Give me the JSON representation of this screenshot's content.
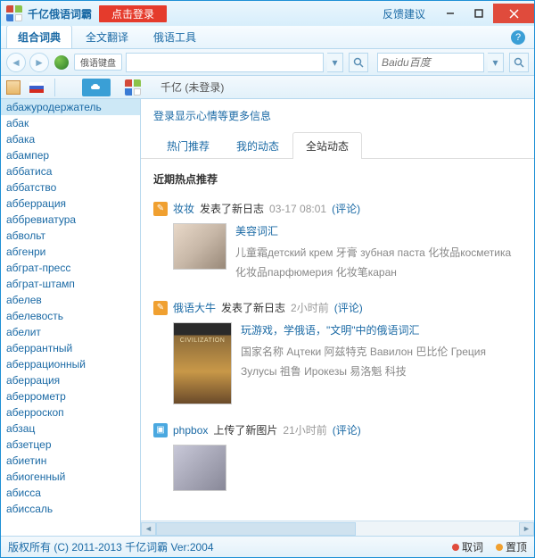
{
  "titlebar": {
    "app_title": "千亿俄语词霸",
    "login_btn": "点击登录",
    "feedback": "反馈建议"
  },
  "menubar": {
    "tabs": [
      "组合词典",
      "全文翻译",
      "俄语工具"
    ]
  },
  "toolbar": {
    "kb_chip": "俄语键盘",
    "baidu_placeholder": "Baidu百度"
  },
  "iconbar": {
    "qianyi_label": "千亿 (未登录)"
  },
  "sidebar": {
    "words": [
      "абажуродержатель",
      "абак",
      "абака",
      "абампер",
      "аббатиса",
      "аббатство",
      "абберрация",
      "аббревиатура",
      "абвольт",
      "абгенри",
      "абграт-пресс",
      "абграт-штамп",
      "абелев",
      "абелевость",
      "абелит",
      "аберрантный",
      "аберрационный",
      "аберрация",
      "аберрометр",
      "аберроскоп",
      "абзац",
      "абзетцер",
      "абиетин",
      "абиогенный",
      "абисса",
      "абиссаль"
    ]
  },
  "content": {
    "login_hint": "登录显示心情等更多信息",
    "tabs": [
      "热门推荐",
      "我的动态",
      "全站动态"
    ],
    "section_title": "近期热点推荐",
    "action_journal": "发表了新日志",
    "action_image": "上传了新图片",
    "comment_label": "(评论)",
    "posts": [
      {
        "user": "妆妆",
        "ts": "03-17 08:01",
        "title": "美容词汇",
        "desc": "儿童霜детский крем 牙膏  зубная паста  化妆品косметика  化妆品парфюмерия  化妆笔каран"
      },
      {
        "user": "俄语大牛",
        "ts": "2小时前",
        "title": "玩游戏，学俄语，\"文明\"中的俄语词汇",
        "desc": "国家名称  Ацтеки 阿兹特克  Вавилон 巴比伦  Греция  Зулусы 祖鲁  Ирокезы 易洛魁  科技"
      },
      {
        "user": "phpbox",
        "ts": "21小时前"
      }
    ]
  },
  "statusbar": {
    "copyright": "版权所有 (C) 2011-2013 千亿词霸 Ver:2004",
    "quci": "取词",
    "zhiding": "置顶"
  }
}
